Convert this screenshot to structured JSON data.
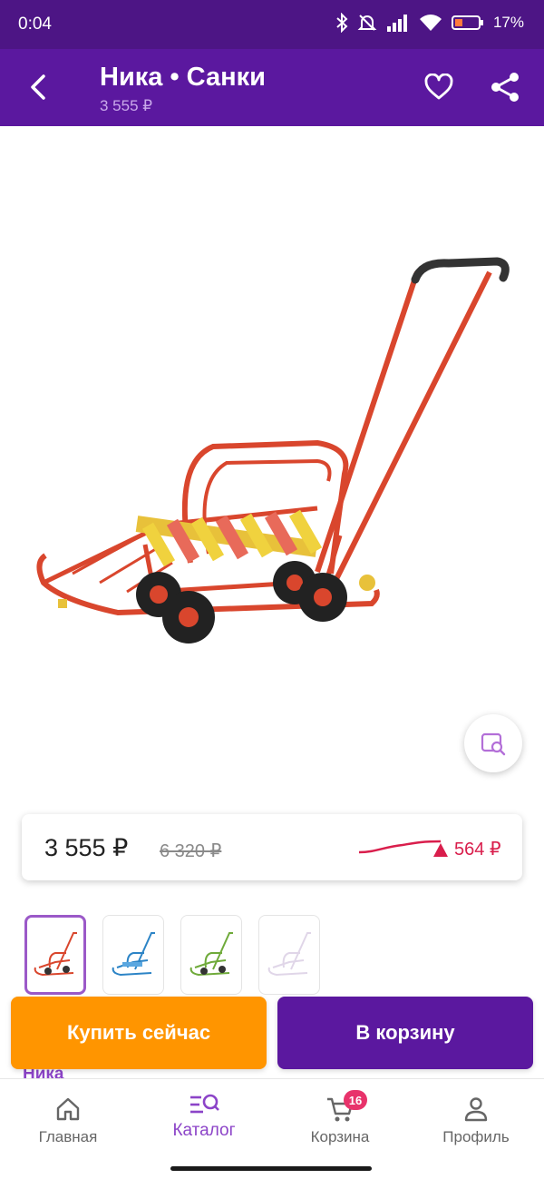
{
  "status_bar": {
    "time": "0:04",
    "battery": "17%",
    "icons": [
      "bluetooth-icon",
      "bell-off-icon",
      "signal-icon",
      "wifi-icon",
      "battery-icon"
    ]
  },
  "header": {
    "title": "Ника • Санки",
    "subtitle": "3 555 ₽",
    "icons": [
      "back-arrow-icon",
      "heart-icon",
      "share-icon"
    ]
  },
  "product": {
    "image_icon": "sled-with-wheels-and-handle",
    "zoom_icon": "image-search-icon"
  },
  "price_card": {
    "current_price": "3 555 ₽",
    "old_price": "6 320 ₽",
    "change": "564 ₽",
    "trend_icon": "price-trend-line"
  },
  "thumbnails": [
    {
      "color": "#d9462d",
      "selected": true
    },
    {
      "color": "#2c84c6",
      "selected": false
    },
    {
      "color": "#6faa3a",
      "selected": false
    },
    {
      "color": "#c9b6d6",
      "selected": false
    }
  ],
  "brand_peek": "Ника",
  "actions": {
    "buy_now": "Купить сейчас",
    "add_to_cart": "В корзину"
  },
  "bottom_nav": {
    "items": [
      {
        "label": "Главная",
        "icon": "home-icon",
        "active": false
      },
      {
        "label": "Каталог",
        "icon": "catalog-search-icon",
        "active": true
      },
      {
        "label": "Корзина",
        "icon": "cart-icon",
        "active": false,
        "badge": "16"
      },
      {
        "label": "Профиль",
        "icon": "profile-icon",
        "active": false
      }
    ]
  },
  "colors": {
    "app_bar": "#5b189f",
    "status_bar": "#4d1585",
    "accent_orange": "#ff9500",
    "accent_purple": "#8c44c8",
    "price_up": "#d91e4c",
    "badge": "#e8336b"
  }
}
